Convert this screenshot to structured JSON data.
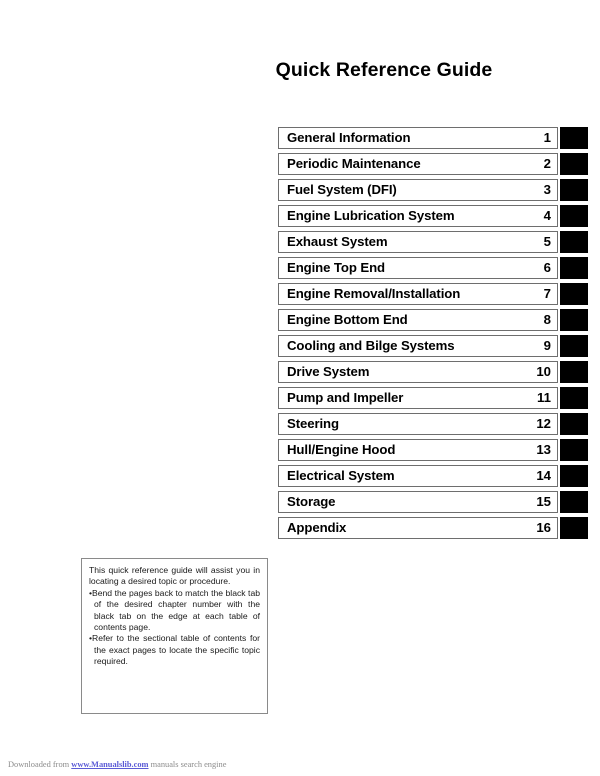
{
  "document": {
    "title": "Quick Reference Guide"
  },
  "chapters": [
    {
      "label": "General Information",
      "number": "1"
    },
    {
      "label": "Periodic Maintenance",
      "number": "2"
    },
    {
      "label": "Fuel System (DFI)",
      "number": "3"
    },
    {
      "label": "Engine Lubrication System",
      "number": "4"
    },
    {
      "label": "Exhaust System",
      "number": "5"
    },
    {
      "label": "Engine Top End",
      "number": "6"
    },
    {
      "label": "Engine Removal/Installation",
      "number": "7"
    },
    {
      "label": "Engine Bottom End",
      "number": "8"
    },
    {
      "label": "Cooling and Bilge Systems",
      "number": "9"
    },
    {
      "label": "Drive System",
      "number": "10"
    },
    {
      "label": "Pump and Impeller",
      "number": "11"
    },
    {
      "label": "Steering",
      "number": "12"
    },
    {
      "label": "Hull/Engine Hood",
      "number": "13"
    },
    {
      "label": "Electrical System",
      "number": "14"
    },
    {
      "label": "Storage",
      "number": "15"
    },
    {
      "label": "Appendix",
      "number": "16"
    }
  ],
  "note": {
    "intro": "This quick reference guide will assist you in locating a desired topic or procedure.",
    "bullets": [
      "•Bend the pages back to match the black tab of the desired chapter number with the black tab on the edge at each table of contents page.",
      "•Refer to the sectional table of contents for the exact pages to locate the specific topic required."
    ]
  },
  "footer": {
    "prefix": "Downloaded from ",
    "link": "www.Manualslib.com",
    "suffix": " manuals search engine"
  }
}
